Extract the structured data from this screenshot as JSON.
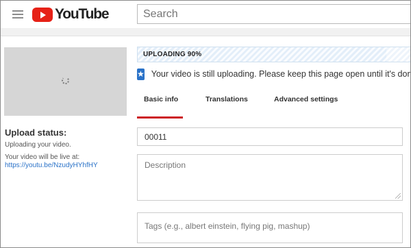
{
  "header": {
    "brand": "YouTube",
    "search_placeholder": "Search",
    "menu_icon": "hamburger-menu-icon",
    "logo_icon": "youtube-play-logo-icon",
    "brand_color": "#e62117"
  },
  "left": {
    "thumbnail_icon": "loading-spinner-icon",
    "upload_status_title": "Upload status:",
    "upload_status_text": "Uploading your video.",
    "live_at_label": "Your video will be live at:",
    "live_url": "https://youtu.be/NzudyHYhfHY"
  },
  "upload": {
    "progress_label": "UPLOADING 90%",
    "progress_percent": 90,
    "notice_icon": "star-icon",
    "notice_text": "Your video is still uploading. Please keep this page open until it's done."
  },
  "tabs": [
    {
      "label": "Basic info",
      "active": true
    },
    {
      "label": "Translations",
      "active": false
    },
    {
      "label": "Advanced settings",
      "active": false
    }
  ],
  "form": {
    "title_value": "00011",
    "description_placeholder": "Description",
    "tags_placeholder": "Tags (e.g., albert einstein, flying pig, mashup)"
  },
  "colors": {
    "accent_red": "#cc181e",
    "link_blue": "#2a72c8"
  }
}
